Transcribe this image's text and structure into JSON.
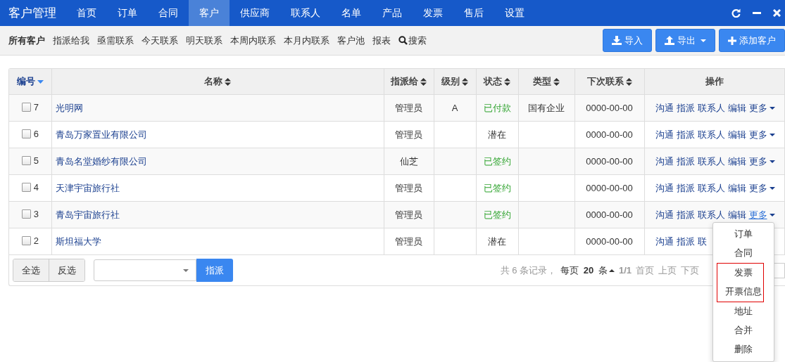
{
  "app_title": "客户管理",
  "nav": [
    {
      "label": "首页",
      "selected": false
    },
    {
      "label": "订单",
      "selected": false
    },
    {
      "label": "合同",
      "selected": false
    },
    {
      "label": "客户",
      "selected": true
    },
    {
      "label": "供应商",
      "selected": false
    },
    {
      "label": "联系人",
      "selected": false
    },
    {
      "label": "名单",
      "selected": false
    },
    {
      "label": "产品",
      "selected": false
    },
    {
      "label": "发票",
      "selected": false
    },
    {
      "label": "售后",
      "selected": false
    },
    {
      "label": "设置",
      "selected": false
    }
  ],
  "filters": [
    {
      "label": "所有客户",
      "selected": true
    },
    {
      "label": "指派给我",
      "selected": false
    },
    {
      "label": "亟需联系",
      "selected": false
    },
    {
      "label": "今天联系",
      "selected": false
    },
    {
      "label": "明天联系",
      "selected": false
    },
    {
      "label": "本周内联系",
      "selected": false
    },
    {
      "label": "本月内联系",
      "selected": false
    },
    {
      "label": "客户池",
      "selected": false
    },
    {
      "label": "报表",
      "selected": false
    },
    {
      "label": "搜索",
      "kind": "search",
      "selected": false
    }
  ],
  "toolbar_buttons": [
    {
      "label": "导入",
      "kind": "import"
    },
    {
      "label": "导出",
      "kind": "export"
    },
    {
      "label": "添加客户",
      "kind": "add"
    }
  ],
  "table": {
    "columns": [
      {
        "label": "编号",
        "sortable": true,
        "sorted": true
      },
      {
        "label": "名称",
        "sortable": true,
        "sorted": false
      },
      {
        "label": "指派给",
        "sortable": true,
        "sorted": false
      },
      {
        "label": "级别",
        "sortable": true,
        "sorted": false
      },
      {
        "label": "状态",
        "sortable": true,
        "sorted": false
      },
      {
        "label": "类型",
        "sortable": true,
        "sorted": false
      },
      {
        "label": "下次联系",
        "sortable": true,
        "sorted": false
      },
      {
        "label": "操作",
        "sortable": false
      }
    ],
    "rows": [
      {
        "checked": false,
        "id": "7",
        "name": "光明网",
        "assignee": "管理员",
        "level": "A",
        "status": {
          "label": "已付款",
          "kind": "success"
        },
        "type": "国有企业",
        "next_contact": "0000-00-00",
        "actions": [
          "沟通",
          "指派",
          "联系人",
          "编辑"
        ],
        "more": "更多",
        "more_open": false
      },
      {
        "checked": false,
        "id": "6",
        "name": "青岛万家置业有限公司",
        "assignee": "管理员",
        "status": {
          "label": "潜在",
          "kind": "plain"
        },
        "next_contact": "0000-00-00",
        "actions": [
          "沟通",
          "指派",
          "联系人",
          "编辑"
        ],
        "more": "更多",
        "more_open": false
      },
      {
        "checked": false,
        "id": "5",
        "name": "青岛名堂婚纱有限公司",
        "assignee": "仙芝",
        "status": {
          "label": "已签约",
          "kind": "success"
        },
        "next_contact": "0000-00-00",
        "actions": [
          "沟通",
          "指派",
          "联系人",
          "编辑"
        ],
        "more": "更多",
        "more_open": false
      },
      {
        "checked": false,
        "id": "4",
        "name": "天津宇宙旅行社",
        "assignee": "管理员",
        "status": {
          "label": "已签约",
          "kind": "success"
        },
        "next_contact": "0000-00-00",
        "actions": [
          "沟通",
          "指派",
          "联系人",
          "编辑"
        ],
        "more": "更多",
        "more_open": false
      },
      {
        "checked": false,
        "id": "3",
        "name": "青岛宇宙旅行社",
        "assignee": "管理员",
        "status": {
          "label": "已签约",
          "kind": "success"
        },
        "next_contact": "0000-00-00",
        "actions": [
          "沟通",
          "指派",
          "联系人",
          "编辑"
        ],
        "more": "更多",
        "more_open": true
      },
      {
        "checked": false,
        "id": "2",
        "name": "斯坦福大学",
        "assignee": "管理员",
        "status": {
          "label": "潜在",
          "kind": "plain"
        },
        "next_contact": "0000-00-00",
        "actions": [
          "沟通",
          "指派",
          "联"
        ]
      }
    ]
  },
  "more_menu": [
    {
      "label": "订单",
      "highlighted": false
    },
    {
      "label": "合同",
      "highlighted": false
    },
    {
      "label": "发票",
      "highlighted": true
    },
    {
      "label": "开票信息",
      "highlighted": true
    },
    {
      "label": "地址",
      "highlighted": false
    },
    {
      "label": "合并",
      "highlighted": false
    },
    {
      "label": "删除",
      "highlighted": false
    }
  ],
  "footer": {
    "select_all": "全选",
    "invert": "反选",
    "assign_button": "指派",
    "summary": "共 6 条记录，",
    "page_size": "每页 **20** 条",
    "page_count": "1/1",
    "pager": [
      "首页",
      "上页",
      "下页"
    ]
  }
}
